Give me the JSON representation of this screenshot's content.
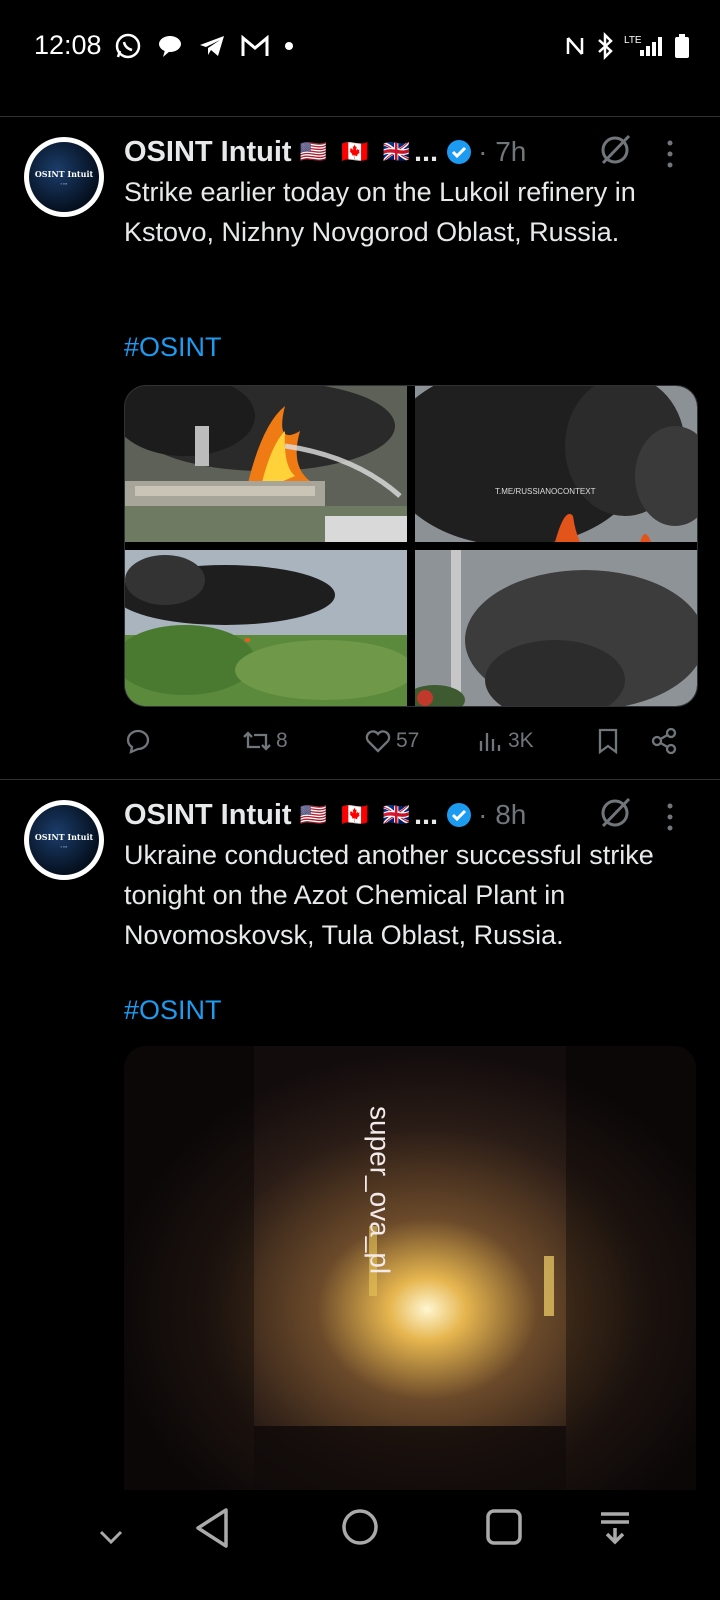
{
  "status_bar": {
    "time": "12:08",
    "left_icons": [
      "whatsapp-icon",
      "chat-bubble-icon",
      "telegram-icon",
      "gmail-icon",
      "dot-icon"
    ],
    "right_icons": [
      "nfc-icon",
      "bluetooth-icon",
      "lte-signal-icon",
      "battery-icon"
    ],
    "network": "LTE"
  },
  "tweets": [
    {
      "author": "OSINT Intuit",
      "avatar_text": "OSINT Intuit",
      "flags": "🇺🇸 🇨🇦 🇬🇧",
      "ellipsis": "...",
      "time": "· 7h",
      "text": "Strike earlier today on the Lukoil refinery in Kstovo, Nizhny Novgorod Oblast, Russia.",
      "hashtag": "#OSINT",
      "watermark": "T.ME/RUSSIANOCONTEXT",
      "retweets": "8",
      "likes": "57",
      "views": "3K"
    },
    {
      "author": "OSINT Intuit",
      "avatar_text": "OSINT Intuit",
      "flags": "🇺🇸 🇨🇦 🇬🇧",
      "ellipsis": "...",
      "time": "· 8h",
      "text": "Ukraine conducted another successful strike tonight on the Azot Chemical Plant in Novomoskovsk, Tula Oblast, Russia.",
      "hashtag": "#OSINT",
      "video_overlay": "super_ova_pl"
    }
  ],
  "colors": {
    "accent": "#1d9bf0",
    "muted": "#71767b",
    "text": "#e7e9ea",
    "background": "#000000"
  },
  "nav_bar": {
    "icons": [
      "chevron-down-icon",
      "back-icon",
      "home-icon",
      "recents-icon",
      "menu-down-icon"
    ]
  }
}
